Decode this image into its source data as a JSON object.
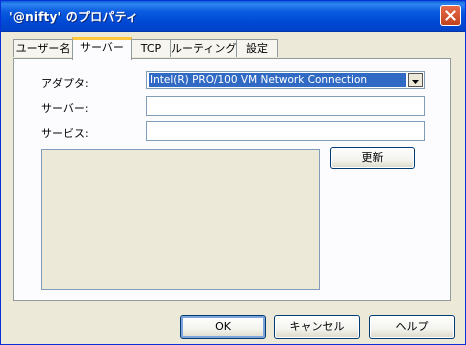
{
  "window": {
    "title": "'@nifty' のプロパティ"
  },
  "tabs": [
    {
      "label": "ユーザー名",
      "active": false
    },
    {
      "label": "サーバー",
      "active": true
    },
    {
      "label": "TCP",
      "active": false
    },
    {
      "label": "ルーティング",
      "active": false
    },
    {
      "label": "設定",
      "active": false
    }
  ],
  "form": {
    "adapter_label": "アダプタ:",
    "adapter_value": "Intel(R) PRO/100 VM Network Connection",
    "server_label": "サーバー:",
    "server_value": "",
    "service_label": "サービス:",
    "service_value": ""
  },
  "buttons": {
    "refresh": "更新",
    "ok": "OK",
    "cancel": "キャンセル",
    "help": "ヘルプ"
  },
  "colors": {
    "titlebar": "#0a5be0",
    "dialog_bg": "#ece9d8",
    "selection": "#316ac5",
    "active_tab_accent": "#ffc83c",
    "close_button": "#c2421e"
  },
  "icons": {
    "close": "close-icon",
    "dropdown": "chevron-down-icon"
  }
}
